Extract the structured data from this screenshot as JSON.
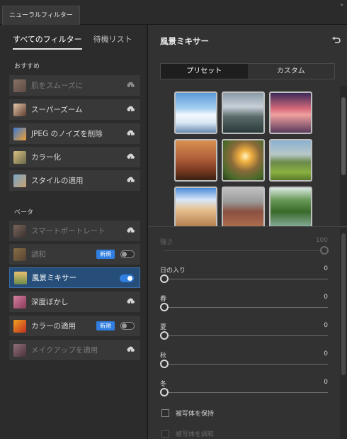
{
  "window": {
    "tab_label": "ニューラルフィルター",
    "collapse_glyph": "»"
  },
  "left": {
    "tabs": [
      {
        "label": "すべてのフィルター",
        "active": true
      },
      {
        "label": "待機リスト",
        "active": false
      }
    ],
    "sections": [
      {
        "title": "おすすめ"
      },
      {
        "title": "ベータ"
      }
    ],
    "items": [
      {
        "label": "肌をスムーズに",
        "status": "cloud",
        "dim": true
      },
      {
        "label": "スーパーズーム",
        "status": "cloud",
        "dim": false
      },
      {
        "label": "JPEG のノイズを削除",
        "status": "cloud",
        "dim": false
      },
      {
        "label": "カラー化",
        "status": "cloud",
        "dim": false
      },
      {
        "label": "スタイルの適用",
        "status": "cloud",
        "dim": false
      },
      {
        "label": "スマートポートレート",
        "status": "cloud",
        "dim": true
      },
      {
        "label": "調和",
        "status": "toggle-off",
        "badge": "新規",
        "dim": true
      },
      {
        "label": "風景ミキサー",
        "status": "toggle-on",
        "dim": false,
        "selected": true
      },
      {
        "label": "深度ぼかし",
        "status": "cloud",
        "dim": false
      },
      {
        "label": "カラーの適用",
        "status": "toggle-off",
        "badge": "新規",
        "dim": false
      },
      {
        "label": "メイクアップを適用",
        "status": "cloud",
        "dim": true
      }
    ]
  },
  "right": {
    "title": "風景ミキサー",
    "segments": [
      {
        "label": "プリセット",
        "active": true
      },
      {
        "label": "カスタム",
        "active": false
      }
    ],
    "sliders": [
      {
        "label": "強さ",
        "value": "100",
        "level": 1.0,
        "dim": true
      },
      {
        "label": "日の入り",
        "value": "0",
        "level": 0,
        "dim": false
      },
      {
        "label": "春",
        "value": "0",
        "level": 0,
        "dim": false
      },
      {
        "label": "夏",
        "value": "0",
        "level": 0,
        "dim": false
      },
      {
        "label": "秋",
        "value": "0",
        "level": 0,
        "dim": false
      },
      {
        "label": "冬",
        "value": "0",
        "level": 0,
        "dim": false
      }
    ],
    "checkboxes": [
      {
        "label": "被写体を保持",
        "checked": false,
        "dim": false
      },
      {
        "label": "被写体を調和",
        "checked": false,
        "dim": true
      }
    ]
  },
  "colors": {
    "accent": "#2f7ee0",
    "selected_bg": "#264e79",
    "panel": "#2c2c2c"
  }
}
